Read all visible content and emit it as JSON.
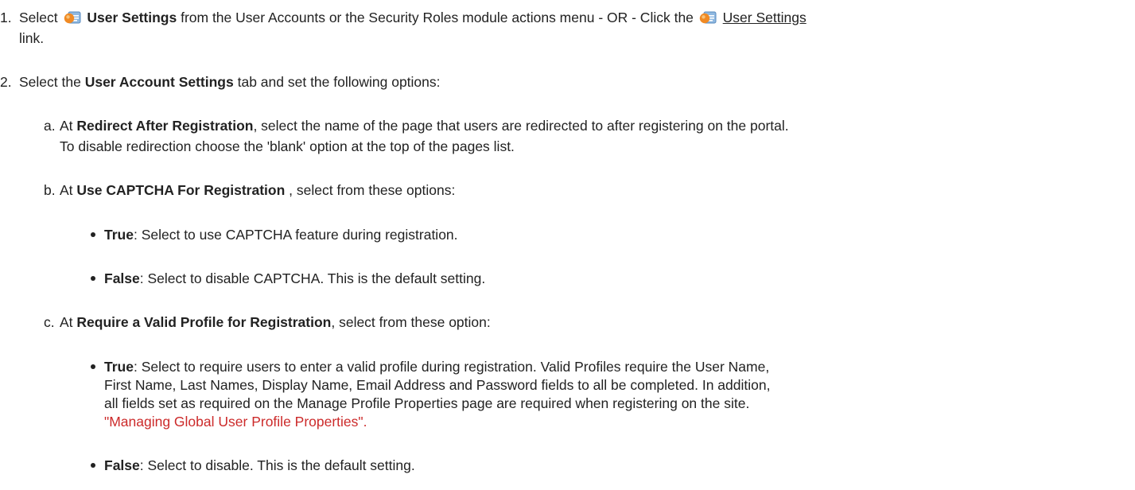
{
  "step1": {
    "number": "1.",
    "select": "Select",
    "bold": "User Settings",
    "mid": "from the User Accounts or the Security Roles module actions menu - OR - Click the",
    "link": "User Settings",
    "line2": "link.",
    "icon": "user-settings-icon"
  },
  "step2": {
    "number": "2.",
    "pre": "Select the",
    "bold": "User Account Settings",
    "post": "tab and set the following options:"
  },
  "item_a": {
    "letter": "a.",
    "pre": "At",
    "bold": "Redirect After Registration",
    "post": ", select the name of the page that users are redirected to after registering on the portal.",
    "line2": "To disable redirection choose the 'blank' option at the top of the pages list."
  },
  "item_b": {
    "letter": "b.",
    "pre": "At",
    "bold": "Use CAPTCHA For Registration",
    "post": " , select from these options:",
    "bullets": [
      {
        "bold": "True",
        "text": ": Select to use CAPTCHA feature during registration."
      },
      {
        "bold": "False",
        "text": ": Select to disable CAPTCHA. This is the default setting."
      }
    ]
  },
  "item_c": {
    "letter": "c.",
    "pre": "At",
    "bold": "Require a Valid Profile for Registration",
    "post": ", select from these option:",
    "bullet_true": {
      "bold": "True",
      "lines": [
        ": Select to require users to enter a valid profile during registration. Valid Profiles require the User Name,",
        "First Name, Last Names, Display Name, Email Address and Password fields to all be completed. In addition,",
        "all fields set as required on the Manage Profile Properties page are required when registering on the site."
      ],
      "link": "\"Managing Global User Profile Properties\"."
    },
    "bullet_false": {
      "bold": "False",
      "text": ": Select to disable. This is the default setting."
    }
  },
  "colors": {
    "text": "#222222",
    "link_red": "#cc2a2a"
  }
}
